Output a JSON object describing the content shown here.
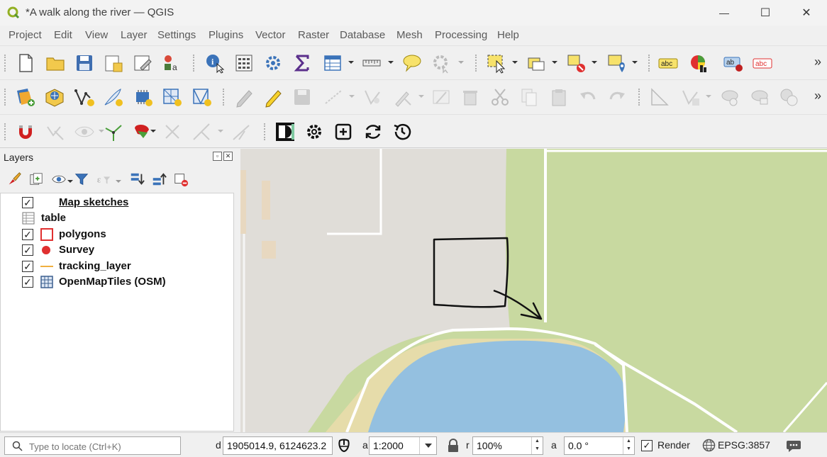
{
  "window": {
    "title": "*A walk along the river — QGIS",
    "minimize_glyph": "—",
    "maximize_glyph": "☐",
    "close_glyph": "✕"
  },
  "menu": [
    "Project",
    "Edit",
    "View",
    "Layer",
    "Settings",
    "Plugins",
    "Vector",
    "Raster",
    "Database",
    "Mesh",
    "Processing",
    "Help"
  ],
  "toolbar_overflow": "»",
  "layers_panel": {
    "title": "Layers",
    "float_glyph": "▫",
    "close_glyph": "✕",
    "layers": [
      {
        "name": "Map sketches",
        "checked": true,
        "icon": "annotation-icon"
      },
      {
        "name": "table",
        "checked": null,
        "icon": "table-icon"
      },
      {
        "name": "polygons",
        "checked": true,
        "icon": "polygon-layer-icon"
      },
      {
        "name": "Survey",
        "checked": true,
        "icon": "point-layer-icon"
      },
      {
        "name": "tracking_layer",
        "checked": true,
        "icon": "line-layer-icon"
      },
      {
        "name": "OpenMapTiles (OSM)",
        "checked": true,
        "icon": "raster-grid-icon"
      }
    ],
    "check_glyph": "✓"
  },
  "statusbar": {
    "locator_placeholder": "Type to locate (Ctrl+K)",
    "coordinate_label": "d",
    "coordinate": "1905014.9, 6124623.2",
    "scale_label": "a",
    "scale": "1:2000",
    "magnifier_label": "r",
    "magnifier": "100%",
    "rotation_label": "a",
    "rotation": "0.0 °",
    "render_label": "Render",
    "render_checked": true,
    "crs": "EPSG:3857",
    "spin_up": "▲",
    "spin_down": "▼"
  },
  "colors": {
    "grass": "#c8d9a0",
    "water": "#94c0e0",
    "sand": "#e6dcaa",
    "urban": "#e0ddd8",
    "sketch": "#111111",
    "accent_red": "#e03030",
    "accent_yellow": "#f0c020"
  }
}
